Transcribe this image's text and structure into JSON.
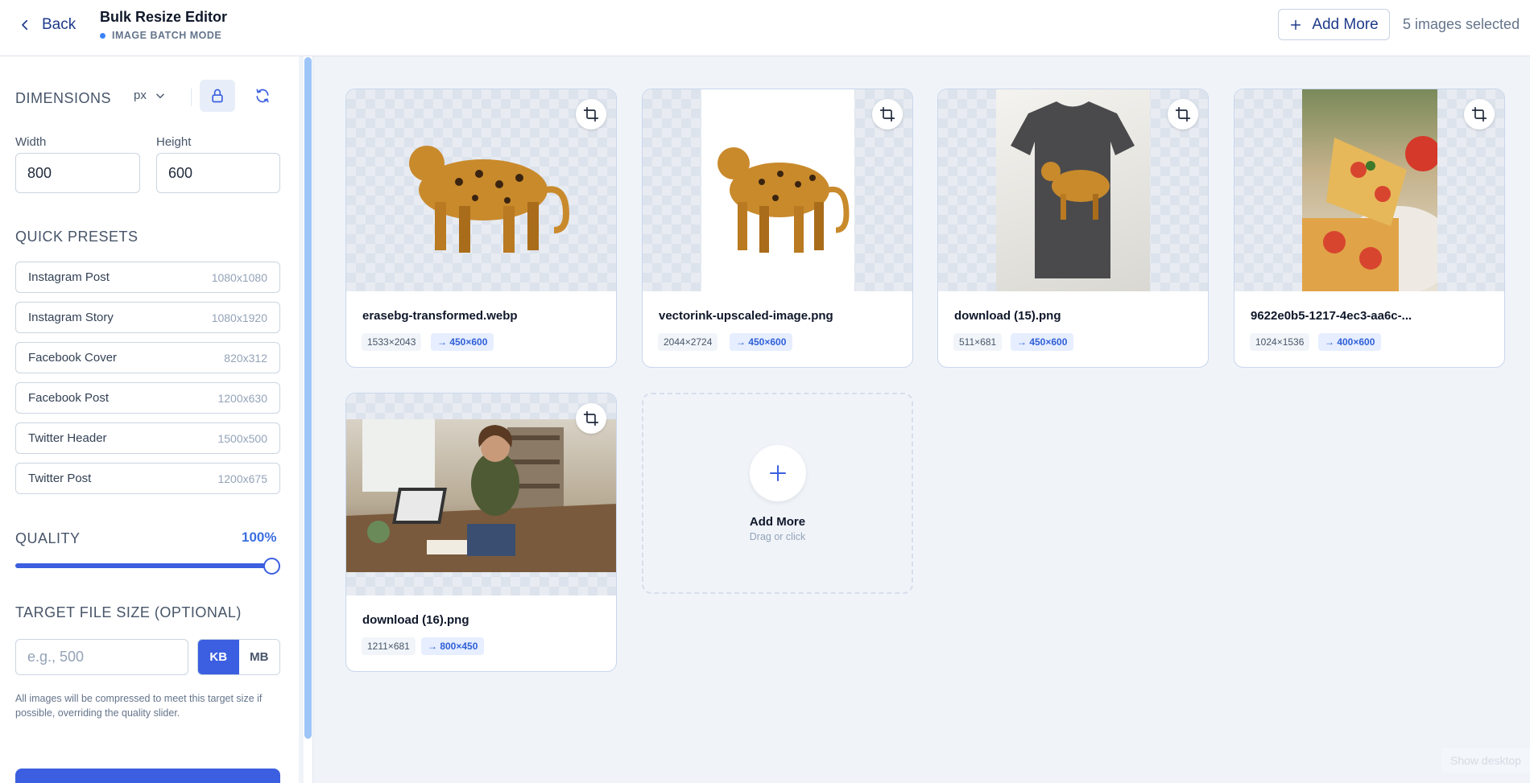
{
  "header": {
    "back_label": "Back",
    "title": "Bulk Resize Editor",
    "mode": "IMAGE BATCH MODE",
    "add_more_label": "Add More",
    "selected_count": "5 images selected"
  },
  "sidebar": {
    "dimensions_title": "DIMENSIONS",
    "unit": "px",
    "width_label": "Width",
    "width_value": "800",
    "height_label": "Height",
    "height_value": "600",
    "presets_title": "QUICK PRESETS",
    "presets": [
      {
        "name": "Instagram Post",
        "size": "1080x1080"
      },
      {
        "name": "Instagram Story",
        "size": "1080x1920"
      },
      {
        "name": "Facebook Cover",
        "size": "820x312"
      },
      {
        "name": "Facebook Post",
        "size": "1200x630"
      },
      {
        "name": "Twitter Header",
        "size": "1500x500"
      },
      {
        "name": "Twitter Post",
        "size": "1200x675"
      }
    ],
    "quality_title": "QUALITY",
    "quality_value": "100%",
    "quality_level": 1.0,
    "target_title": "TARGET FILE SIZE (OPTIONAL)",
    "target_placeholder": "e.g., 500",
    "unit_kb": "KB",
    "unit_mb": "MB",
    "help_text": "All images will be compressed to meet this target size if possible, overriding the quality slider."
  },
  "images": [
    {
      "name": "erasebg-transformed.webp",
      "original": "1533×2043",
      "target": "→ 450×600"
    },
    {
      "name": "vectorink-upscaled-image.png",
      "original": "2044×2724",
      "target": "→ 450×600"
    },
    {
      "name": "download (15).png",
      "original": "511×681",
      "target": "→ 450×600"
    },
    {
      "name": "9622e0b5-1217-4ec3-aa6c-...",
      "original": "1024×1536",
      "target": "→ 400×600"
    },
    {
      "name": "download (16).png",
      "original": "1211×681",
      "target": "→ 800×450"
    }
  ],
  "add_card": {
    "title": "Add More",
    "subtitle": "Drag or click"
  },
  "footer": {
    "show_desktop": "Show desktop"
  },
  "colors": {
    "accent": "#3b5fe0",
    "navy": "#1e3a8a",
    "background": "#f0f4f9"
  }
}
